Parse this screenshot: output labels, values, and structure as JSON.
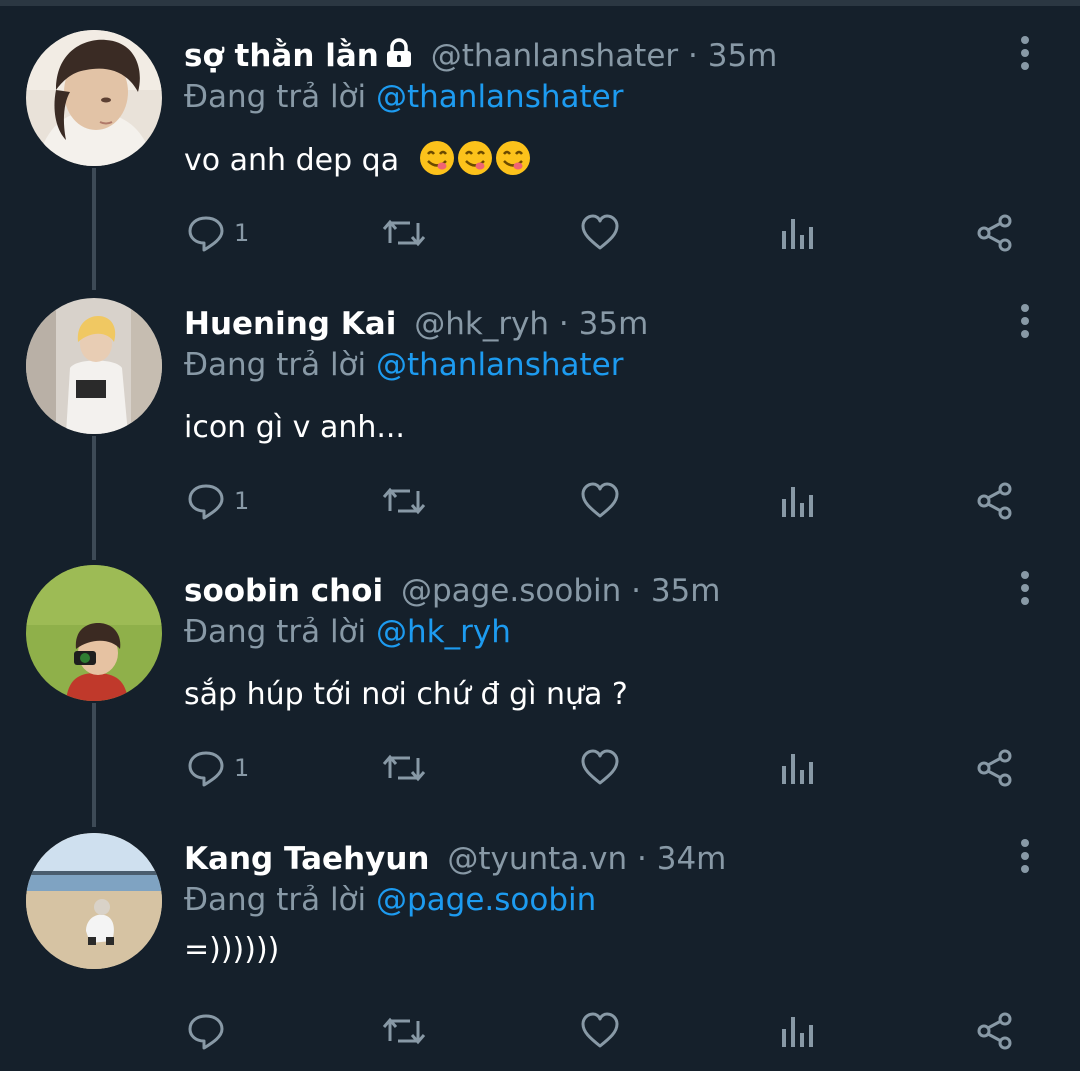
{
  "tweets": [
    {
      "name": "sợ thằn lằn",
      "locked": true,
      "handle": "@thanlanshater",
      "dot": " · ",
      "time": "35m",
      "reply_prefix": "Đang trả lời",
      "reply_to": "@thanlanshater",
      "text": "vo anh dep qa",
      "emoji": [
        "face-savoring-food",
        "face-savoring-food",
        "face-savoring-food"
      ],
      "reply_count": "1"
    },
    {
      "name": "Huening Kai",
      "locked": false,
      "handle": "@hk_ryh",
      "dot": " · ",
      "time": "35m",
      "reply_prefix": "Đang trả lời",
      "reply_to": "@thanlanshater",
      "text": "icon gì v anh...",
      "emoji": [],
      "reply_count": "1"
    },
    {
      "name": "soobin choi",
      "locked": false,
      "handle": "@page.soobin",
      "dot": " · ",
      "time": "35m",
      "reply_prefix": "Đang trả lời",
      "reply_to": "@hk_ryh",
      "text": "sắp húp tới nơi chứ đ gì nựa ?",
      "emoji": [],
      "reply_count": "1"
    },
    {
      "name": "Kang Taehyun",
      "locked": false,
      "handle": "@tyunta.vn",
      "dot": " · ",
      "time": "34m",
      "reply_prefix": "Đang trả lời",
      "reply_to": "@page.soobin",
      "text": "=))))))",
      "emoji": [],
      "reply_count": ""
    }
  ],
  "icons": {
    "reply": "reply-icon",
    "retweet": "retweet-icon",
    "like": "heart-icon",
    "analytics": "analytics-icon",
    "share": "share-icon",
    "more": "more-vertical-icon",
    "lock": "lock-icon"
  },
  "colors": {
    "background": "#15202b",
    "text": "#ffffff",
    "muted": "#8899a6",
    "mention": "#1d9bf0",
    "thread_line": "#3d4a56"
  }
}
